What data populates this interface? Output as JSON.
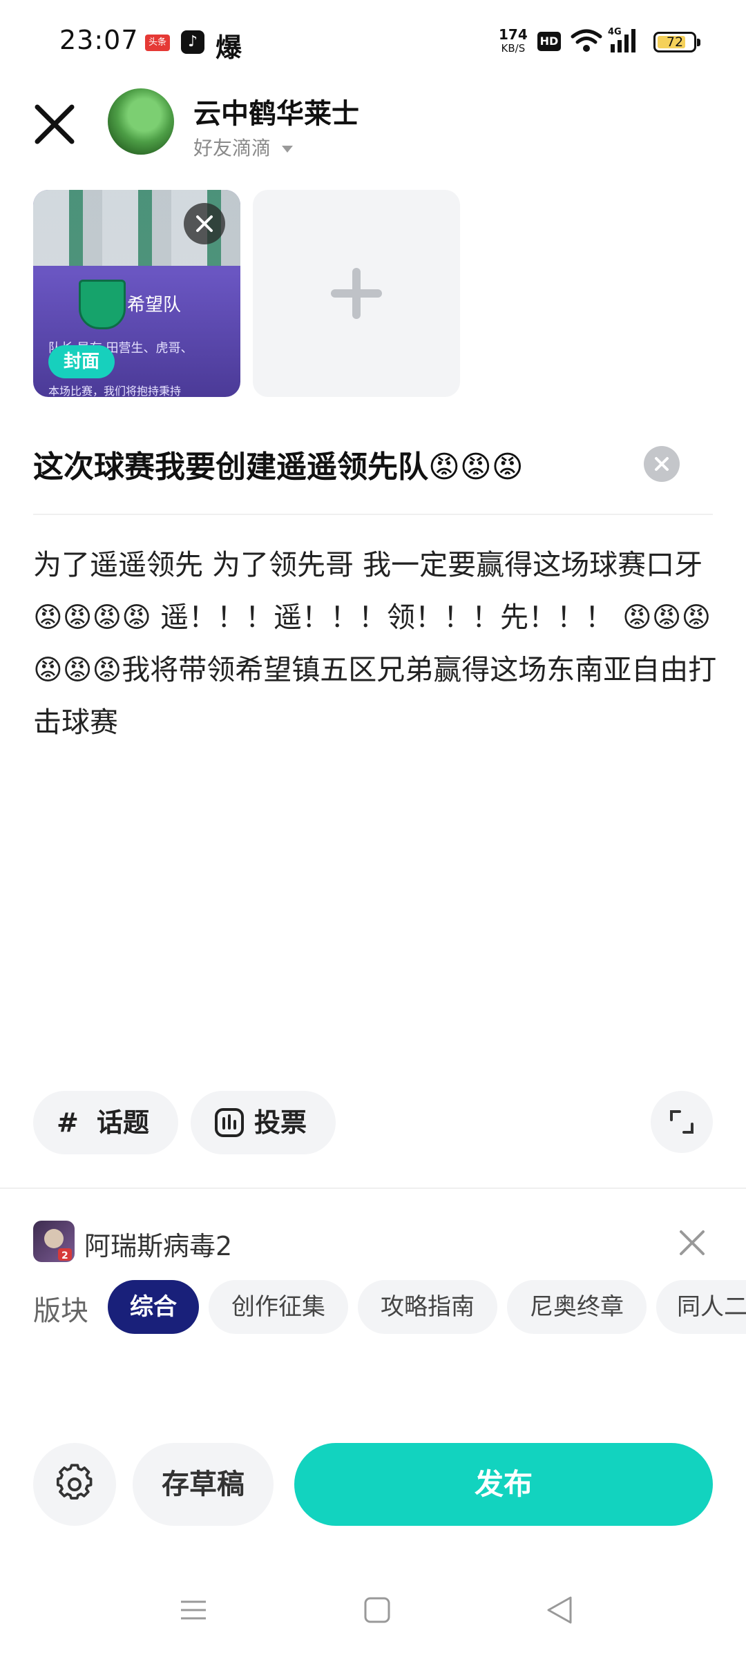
{
  "status_bar": {
    "time": "23:07",
    "toutiao_label": "头条",
    "hot_label": "爆",
    "net_speed": "174",
    "net_speed_unit": "KB/S",
    "hd_label": "HD",
    "network": "4G",
    "battery": "72"
  },
  "header": {
    "user_name": "云中鹤华莱士",
    "friend_group": "好友滴滴"
  },
  "media": {
    "cover_label": "封面",
    "cover_team_text": "希望队",
    "cover_small_text": "队长 导存  田营生、虎哥、",
    "cover_small_text2": "本场比赛，我们将抱持秉持"
  },
  "post": {
    "title": "这次球赛我要创建遥遥领先队😡😡😡",
    "body": "为了遥遥领先 为了领先哥 我一定要赢得这场球赛口牙😡😡😡😡 遥！！！遥！！！领！！！先！！！ 😡😡😡😡😡😡我将带领希望镇五区兄弟赢得这场东南亚自由打击球赛"
  },
  "tools": {
    "topic_label": "话题",
    "vote_label": "投票"
  },
  "game": {
    "name": "阿瑞斯病毒2"
  },
  "sections": {
    "label": "版块",
    "items": [
      "综合",
      "创作征集",
      "攻略指南",
      "尼奥终章",
      "同人二"
    ],
    "active_index": 0
  },
  "actions": {
    "draft_label": "存草稿",
    "publish_label": "发布"
  },
  "colors": {
    "accent": "#12d3bf",
    "active_chip": "#19207a",
    "chip_bg": "#f3f4f6"
  }
}
